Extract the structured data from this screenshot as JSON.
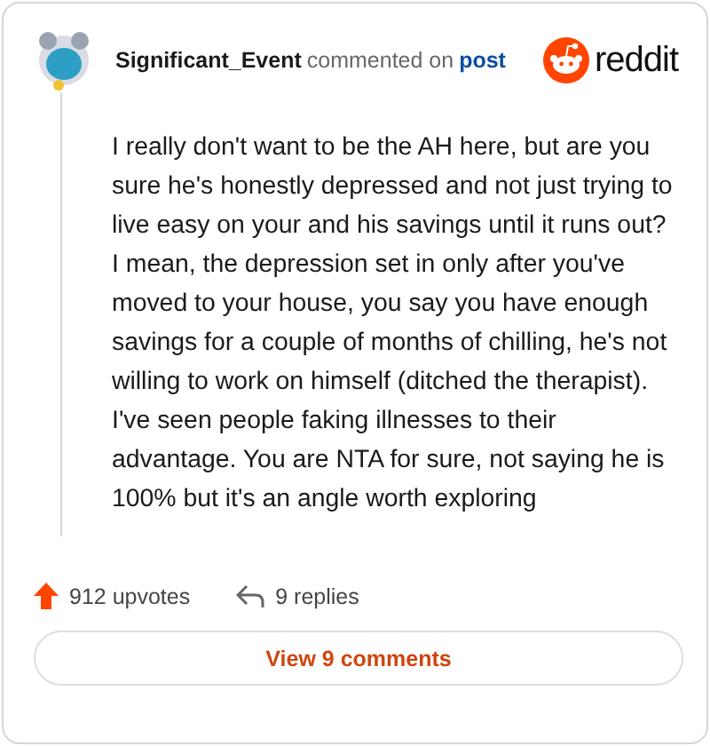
{
  "header": {
    "username": "Significant_Event",
    "action": "commented on",
    "link": "post",
    "brand": "reddit"
  },
  "comment": {
    "text": "I really don't want to be the AH here, but are you sure he's honestly depressed and not just trying to live easy on your and his savings until it runs out? I mean, the depression set in only after you've moved to your house, you say you have enough savings for a couple of months of chilling, he's not willing to work on himself (ditched the therapist). I've seen people faking illnesses to their advantage. You are NTA for sure, not saying he is 100% but it's an angle worth exploring"
  },
  "footer": {
    "upvotes": "912 upvotes",
    "replies": "9 replies"
  },
  "button": "View 9 comments"
}
